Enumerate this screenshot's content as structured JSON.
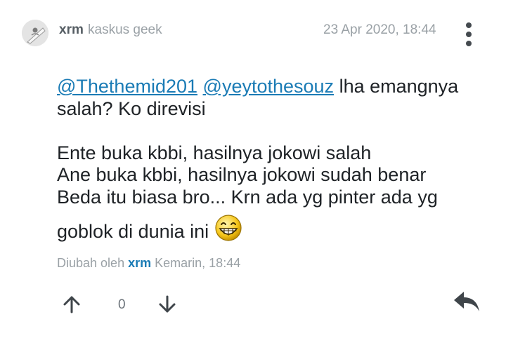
{
  "post": {
    "author": "xrm",
    "author_title": "kaskus geek",
    "timestamp": "23 Apr 2020, 18:44",
    "mention_1": "@Thethemid201",
    "mention_2": "@yeytothesouz",
    "line_1_rest": " lha emangnya",
    "line_2": "salah? Ko direvisi",
    "line_3": "Ente buka kbbi, hasilnya jokowi salah",
    "line_4": "Ane buka kbbi, hasilnya jokowi sudah benar",
    "line_5": "Beda itu biasa bro... Krn ada yg pinter ada yg",
    "line_6": "goblok di dunia ini",
    "emoji_icon": "grinning-emoticon",
    "edited_prefix": "Diubah oleh",
    "edited_by": "xrm",
    "edited_time": "Kemarin, 18:44"
  },
  "actions": {
    "vote_count": "0"
  },
  "colors": {
    "link": "#1a7bb5",
    "muted": "#9aa1a6",
    "text": "#1e2226"
  }
}
